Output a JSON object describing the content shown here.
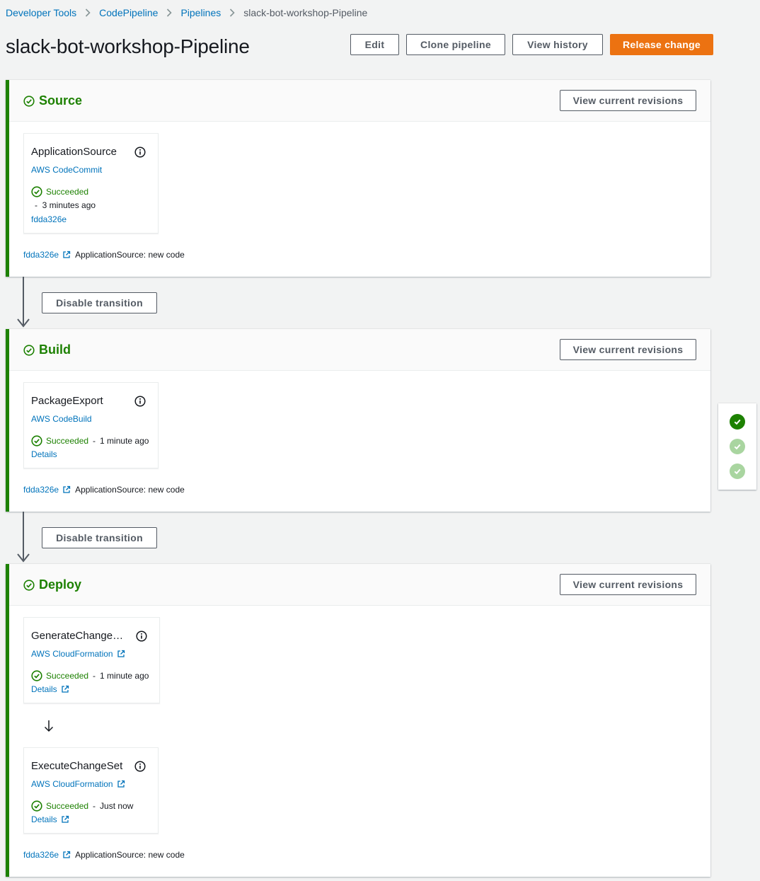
{
  "breadcrumb": {
    "items": [
      "Developer Tools",
      "CodePipeline",
      "Pipelines"
    ],
    "current": "slack-bot-workshop-Pipeline"
  },
  "page": {
    "title": "slack-bot-workshop-Pipeline"
  },
  "toolbar": {
    "edit": "Edit",
    "clone": "Clone pipeline",
    "history": "View history",
    "release": "Release change"
  },
  "colors": {
    "success": "#1d8102",
    "primary": "#ec7211",
    "link": "#0073bb"
  },
  "stages": [
    {
      "name": "Source",
      "button": "View current revisions",
      "actions": [
        {
          "name": "ApplicationSource",
          "provider": "AWS CodeCommit",
          "status": "Succeeded",
          "time": "3 minutes ago",
          "link": "fdda326e"
        }
      ],
      "revision": {
        "id": "fdda326e",
        "message": "ApplicationSource: new code"
      }
    },
    {
      "name": "Build",
      "button": "View current revisions",
      "actions": [
        {
          "name": "PackageExport",
          "provider": "AWS CodeBuild",
          "status": "Succeeded",
          "time": "1 minute ago",
          "link": "Details"
        }
      ],
      "revision": {
        "id": "fdda326e",
        "message": "ApplicationSource: new code"
      }
    },
    {
      "name": "Deploy",
      "button": "View current revisions",
      "actions": [
        {
          "name": "GenerateChange…",
          "provider": "AWS CloudFormation",
          "status": "Succeeded",
          "time": "1 minute ago",
          "link": "Details"
        },
        {
          "name": "ExecuteChangeSet",
          "provider": "AWS CloudFormation",
          "status": "Succeeded",
          "time": "Just now",
          "link": "Details"
        }
      ],
      "revision": {
        "id": "fdda326e",
        "message": "ApplicationSource: new code"
      }
    }
  ],
  "transitions": [
    {
      "label": "Disable transition"
    },
    {
      "label": "Disable transition"
    }
  ],
  "side_nav": {
    "icons": [
      "check-circle-filled-icon",
      "check-circle-light-icon",
      "check-circle-light-icon"
    ]
  }
}
